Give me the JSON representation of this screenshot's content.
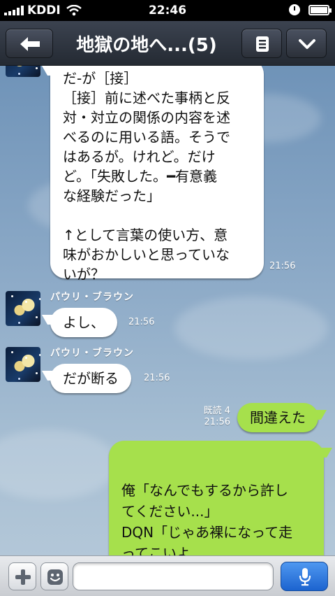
{
  "status_bar": {
    "carrier": "KDDI",
    "time": "22:46",
    "battery_level": 1.0
  },
  "header": {
    "title": "地獄の地へ...(5)",
    "back_icon": "left-arrow-icon",
    "menu_icon": "list-icon",
    "collapse_icon": "chevron-down-icon"
  },
  "messages": [
    {
      "direction": "incoming",
      "text": "だ-が［接］\n［接］前に述べた事柄と反\n対・対立の関係の内容を述\nべるのに用いる語。そうで\nはあるが。けれど。だけ\nど。「失敗した。━有意義\nな経験だった」\n\n↑として言葉の使い方、意\n味がおかしいと思っていな\nいが？",
      "time": "21:56"
    },
    {
      "direction": "incoming",
      "sender": "パウリ・ブラウン",
      "text": "よし、",
      "time": "21:56"
    },
    {
      "direction": "incoming",
      "sender": "パウリ・ブラウン",
      "text": "だが断る",
      "time": "21:56"
    },
    {
      "direction": "outgoing",
      "read_receipt": "既読 4",
      "text": "間違えた",
      "time": "21:56"
    },
    {
      "direction": "outgoing",
      "text": "俺「なんでもするから許し\nてください...」\nDQN「じゃあ裸になって走\nってこいよ...",
      "time": ""
    }
  ],
  "input_bar": {
    "placeholder": "",
    "plus_icon": "plus-icon",
    "emoji_icon": "emoji-icon",
    "mic_icon": "microphone-icon"
  },
  "colors": {
    "header_bg": "#2b3039",
    "outgoing_bubble": "#a6e04c",
    "incoming_bubble": "#ffffff",
    "mic_button": "#1c63cf"
  }
}
